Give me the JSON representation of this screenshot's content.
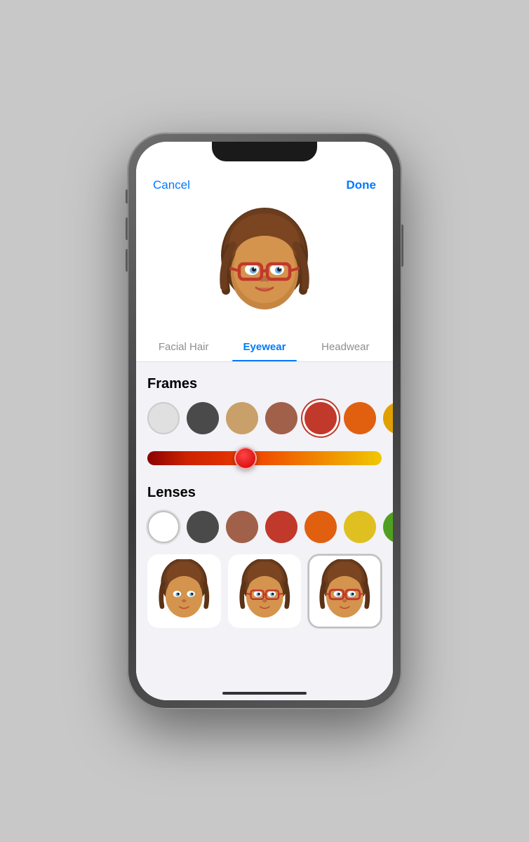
{
  "nav": {
    "cancel_label": "Cancel",
    "done_label": "Done"
  },
  "tabs": [
    {
      "id": "facial-hair",
      "label": "Facial Hair",
      "active": false
    },
    {
      "id": "eyewear",
      "label": "Eyewear",
      "active": true
    },
    {
      "id": "headwear",
      "label": "Headwear",
      "active": false
    }
  ],
  "frames_section": {
    "title": "Frames",
    "swatches": [
      {
        "color": "#e0e0e0",
        "selected": false
      },
      {
        "color": "#4a4a4a",
        "selected": false
      },
      {
        "color": "#c9a06a",
        "selected": false
      },
      {
        "color": "#a0604a",
        "selected": false
      },
      {
        "color": "#c0392b",
        "selected": true
      },
      {
        "color": "#e06010",
        "selected": false
      },
      {
        "color": "#e0a000",
        "selected": false
      }
    ],
    "slider_value": 42
  },
  "lenses_section": {
    "title": "Lenses",
    "swatches": [
      {
        "color": "transparent",
        "selected": true,
        "lens_empty": true
      },
      {
        "color": "#4a4a4a",
        "selected": false
      },
      {
        "color": "#a0604a",
        "selected": false
      },
      {
        "color": "#c0392b",
        "selected": false
      },
      {
        "color": "#e06010",
        "selected": false
      },
      {
        "color": "#e0c020",
        "selected": false
      },
      {
        "color": "#50a020",
        "selected": false
      }
    ]
  },
  "previews": [
    {
      "id": "preview-1",
      "selected": false
    },
    {
      "id": "preview-2",
      "selected": false
    },
    {
      "id": "preview-3",
      "selected": true
    }
  ]
}
